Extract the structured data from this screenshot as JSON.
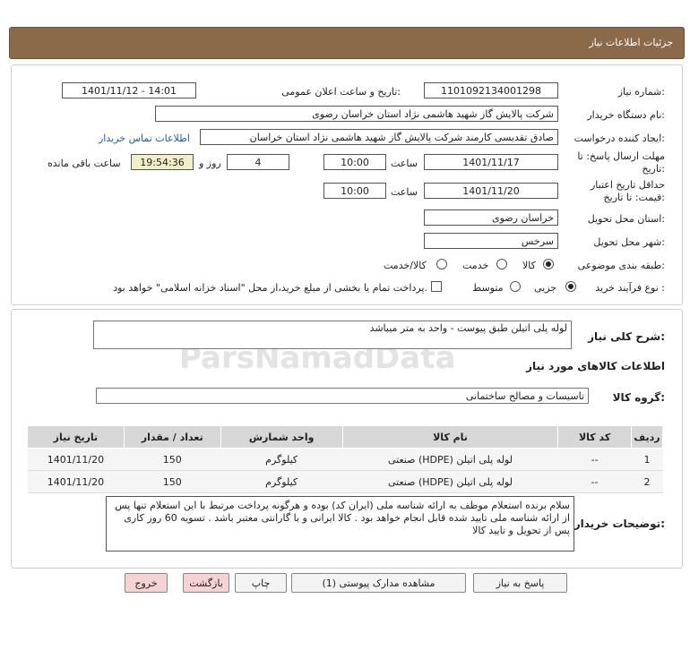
{
  "page_title": "جزئیات اطلاعات نیاز",
  "fields": {
    "need_number_label": "شماره نیاز:",
    "need_number": "1101092134001298",
    "announce_label": "تاریخ و ساعت اعلان عمومی:",
    "announce_value": "1401/11/12 - 14:01",
    "buyer_org_label": "نام دستگاه خریدار:",
    "buyer_org": "شرکت پالایش گاز شهید هاشمی نژاد   استان خراسان رضوی",
    "creator_label": "ایجاد کننده درخواست:",
    "creator": "صادق تقدیسی کارمند شرکت پالایش گاز شهید هاشمی نژاد   استان خراسان",
    "contact_link": "اطلاعات تماس خریدار",
    "deadline_label_1": "مهلت ارسال پاسخ: تا",
    "deadline_label_2": "تاریخ:",
    "deadline_date": "1401/11/17",
    "time_label": "ساعت",
    "deadline_time": "10:00",
    "days_value": "4",
    "days_label": "روز و",
    "remaining_time": "19:54:36",
    "remaining_label": "ساعت باقی مانده",
    "validity_label_1": "حداقل تاریخ اعتبار",
    "validity_label_2": "قیمت: تا تاریخ:",
    "validity_date": "1401/11/20",
    "validity_time": "10:00",
    "province_label": "استان محل تحویل:",
    "province": "خراسان رضوی",
    "city_label": "شهر محل تحویل:",
    "city": "سرخس",
    "category_label": "طبقه بندی موضوعی:",
    "category_options": [
      "کالا",
      "خدمت",
      "کالا/خدمت"
    ],
    "process_label": "نوع فرآیند خرید :",
    "process_options": [
      "جزیی",
      "متوسط"
    ],
    "payment_note": "پرداخت تمام یا بخشی از مبلغ خرید،از محل \"اسناد خزانه اسلامی\" خواهد بود."
  },
  "details": {
    "summary_label": "شرح کلی نیاز:",
    "summary": "لوله پلی اتیلن طبق پیوست - واحد به متر میباشد",
    "goods_info_label": "اطلاعات کالاهای مورد نیاز",
    "goods_group_label": "گروه کالا:",
    "goods_group": "تاسیسات و مصالح ساختمانی",
    "table": {
      "headers": [
        "ردیف",
        "کد کالا",
        "نام کالا",
        "واحد شمارش",
        "تعداد / مقدار",
        "تاریخ نیاز"
      ],
      "rows": [
        [
          "1",
          "--",
          "لوله پلی اتیلن (HDPE) صنعتی",
          "کیلوگرم",
          "150",
          "1401/11/20"
        ],
        [
          "2",
          "--",
          "لوله پلی اتیلن (HDPE) صنعتی",
          "کیلوگرم",
          "150",
          "1401/11/20"
        ]
      ]
    },
    "buyer_notes_label": "توضیحات خریدار:",
    "buyer_notes": "سلام  برنده استعلام موظف به ارائه شناسه ملی (ایران کد) بوده و هرگونه پرداخت مرتبط با این استعلام تنها پس از ارائه شناسه ملی تایید شده قابل انجام خواهد بود . کالا ایرانی و با گارانتی معتبر  باشد . تسویه 60 روز کاری پس از تحویل و تایید کالا"
  },
  "buttons": {
    "reply": "پاسخ به نیاز",
    "attachments": "مشاهده مدارک پیوستی (1)",
    "print": "چاپ",
    "back": "بازگشت",
    "exit": "خروج"
  },
  "watermark": {
    "brand": "ParsNamadData"
  },
  "colors": {
    "header": "#8b6a4a",
    "link": "#1a5fb4",
    "highlight": "#f2efc8"
  }
}
